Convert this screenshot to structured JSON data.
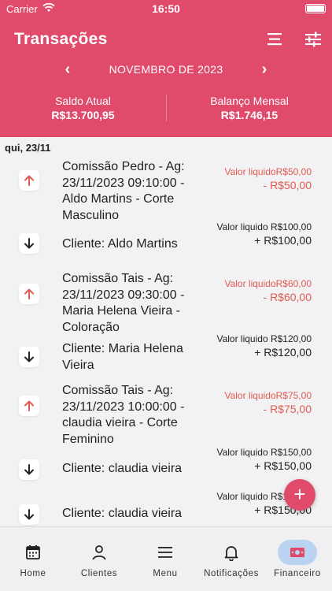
{
  "status_bar": {
    "carrier": "Carrier",
    "time": "16:50"
  },
  "header": {
    "title": "Transações",
    "month": "NOVEMBRO DE 2023",
    "saldo_label": "Saldo Atual",
    "saldo_value": "R$13.700,95",
    "balanco_label": "Balanço Mensal",
    "balanco_value": "R$1.746,15"
  },
  "date_header": "qui, 23/11",
  "transactions": [
    {
      "type": "out",
      "description": "Comissão Pedro - Ag: 23/11/2023 09:10:00 - Aldo Martins - Corte Masculino",
      "sub": "Valor liquidoR$50,00",
      "amount": "- R$50,00"
    },
    {
      "type": "in",
      "description": "Cliente: Aldo Martins",
      "sub": "Valor liquido R$100,00",
      "amount": "+ R$100,00"
    },
    {
      "type": "out",
      "description": "Comissão Tais - Ag: 23/11/2023 09:30:00 - Maria Helena Vieira - Coloração",
      "sub": "Valor liquidoR$60,00",
      "amount": "- R$60,00"
    },
    {
      "type": "in",
      "description": "Cliente: Maria Helena Vieira",
      "sub": "Valor liquido R$120,00",
      "amount": "+ R$120,00"
    },
    {
      "type": "out",
      "description": "Comissão Tais - Ag: 23/11/2023 10:00:00 - claudia vieira  - Corte Feminino",
      "sub": "Valor liquidoR$75,00",
      "amount": "- R$75,00"
    },
    {
      "type": "in",
      "description": "Cliente: claudia vieira",
      "sub": "Valor liquido R$150,00",
      "amount": "+ R$150,00"
    },
    {
      "type": "in",
      "description": "Cliente: claudia vieira",
      "sub": "Valor liquido R$150,00",
      "amount": "+ R$150,00"
    }
  ],
  "fab_label": "+",
  "nav": [
    {
      "label": "Home",
      "icon": "calendar-icon"
    },
    {
      "label": "Clientes",
      "icon": "person-icon"
    },
    {
      "label": "Menu",
      "icon": "menu-icon"
    },
    {
      "label": "Notificações",
      "icon": "bell-icon"
    },
    {
      "label": "Financeiro",
      "icon": "money-icon",
      "active": true
    }
  ],
  "colors": {
    "primary": "#e04a6b",
    "negative": "#e05a4f",
    "active_nav": "#b9d3f0"
  }
}
